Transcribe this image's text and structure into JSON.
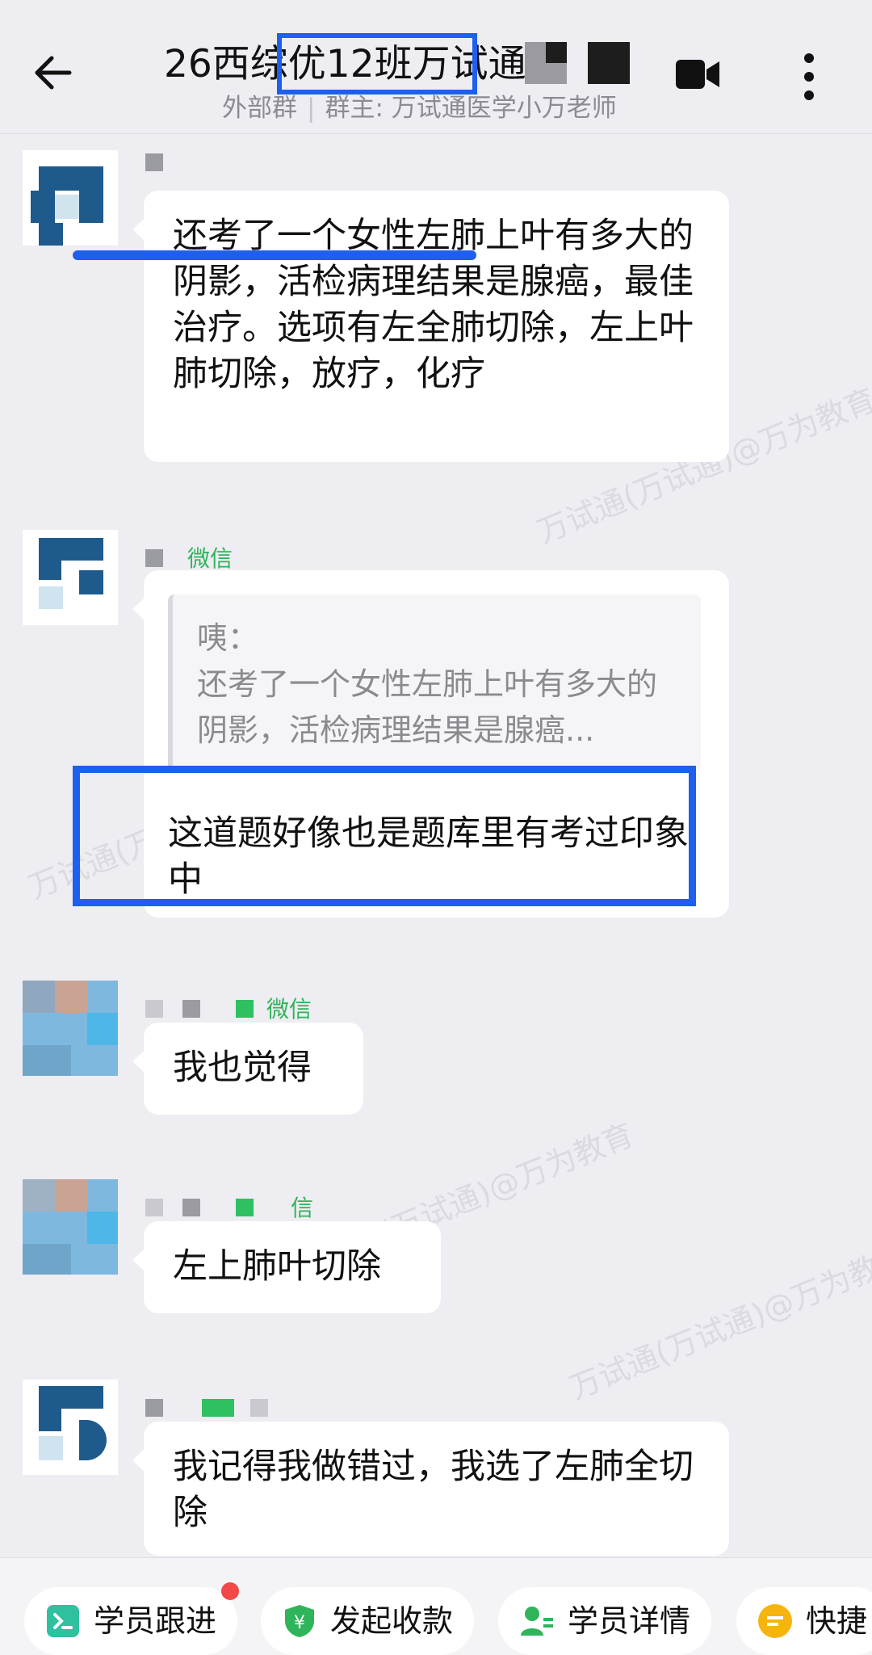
{
  "header": {
    "title": "26西综优12班万试通",
    "subtitle_part1": "外部群",
    "subtitle_sep": "|",
    "subtitle_part2": "群主: 万试通医学小万老师",
    "icons": [
      "back-arrow-icon",
      "video-call-icon",
      "more-vertical-icon"
    ]
  },
  "messages": [
    {
      "text": "还考了一个女性左肺上叶有多大的阴影，活检病理结果是腺癌，最佳治疗。选项有左全肺切除，左上叶肺切除，放疗，化疗"
    },
    {
      "name": "微信",
      "quote_name": "咦：",
      "quote_text": "还考了一个女性左肺上叶有多大的阴影，活检病理结果是腺癌...",
      "text": "这道题好像也是题库里有考过印象中"
    },
    {
      "name": "微信",
      "text": "我也觉得"
    },
    {
      "name": "信",
      "text": "左上肺叶切除"
    },
    {
      "text": "我记得我做错过，我选了左肺全切除"
    }
  ],
  "watermarks": [
    "万试通(万试通)@万为教育",
    "万试通(万试通)@万为教育",
    "万试通(万试通)@万为教育",
    "万试通(万试通)@万为教育"
  ],
  "bottom_bar": {
    "chips": [
      {
        "label": "学员跟进",
        "icon": "follow-up-icon",
        "color": "#2fc0a0"
      },
      {
        "label": "发起收款",
        "icon": "payment-shield-icon",
        "color": "#2fb45a"
      },
      {
        "label": "学员详情",
        "icon": "student-detail-icon",
        "color": "#2fb45a"
      },
      {
        "label": "快捷",
        "icon": "quick-reply-icon",
        "color": "#f5b40f"
      }
    ],
    "badge_color": "#f24848"
  },
  "colors": {
    "highlight": "#1e5ff0",
    "background": "#ededf2",
    "bubble": "#ffffff",
    "accent_green": "#2fc05f"
  }
}
